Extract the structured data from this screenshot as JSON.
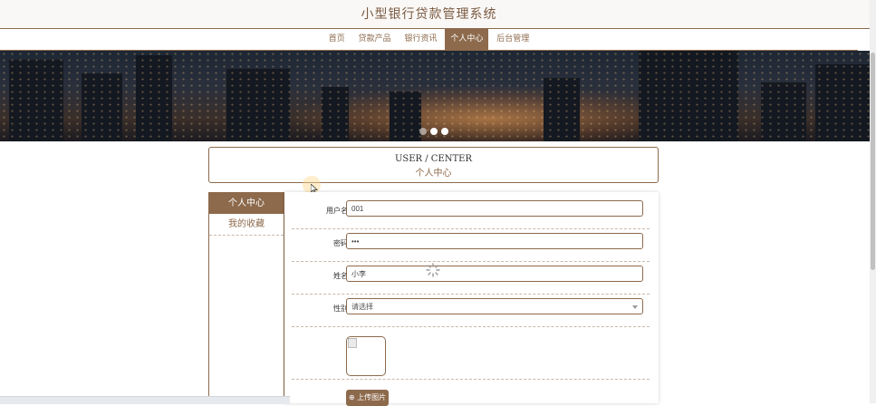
{
  "site": {
    "title": "小型银行贷款管理系统"
  },
  "nav": {
    "items": [
      {
        "label": "首页"
      },
      {
        "label": "贷款产品"
      },
      {
        "label": "银行资讯"
      },
      {
        "label": "个人中心"
      },
      {
        "label": "后台管理"
      }
    ],
    "active_index": 3
  },
  "banner": {
    "slide_count": 3,
    "active_slide": 2
  },
  "center": {
    "title_en": "USER / CENTER",
    "title_cn": "个人中心"
  },
  "sidebar": {
    "items": [
      {
        "label": "个人中心"
      },
      {
        "label": "我的收藏"
      }
    ],
    "active_index": 0
  },
  "form": {
    "username": {
      "label": "用户名",
      "value": "001"
    },
    "password": {
      "label": "密码",
      "value": "•••"
    },
    "name": {
      "label": "姓名",
      "value": "小李"
    },
    "gender": {
      "label": "性别",
      "value": "请选择"
    },
    "upload_label": "上传图片"
  },
  "theme": {
    "accent": "#8d6a4c"
  }
}
